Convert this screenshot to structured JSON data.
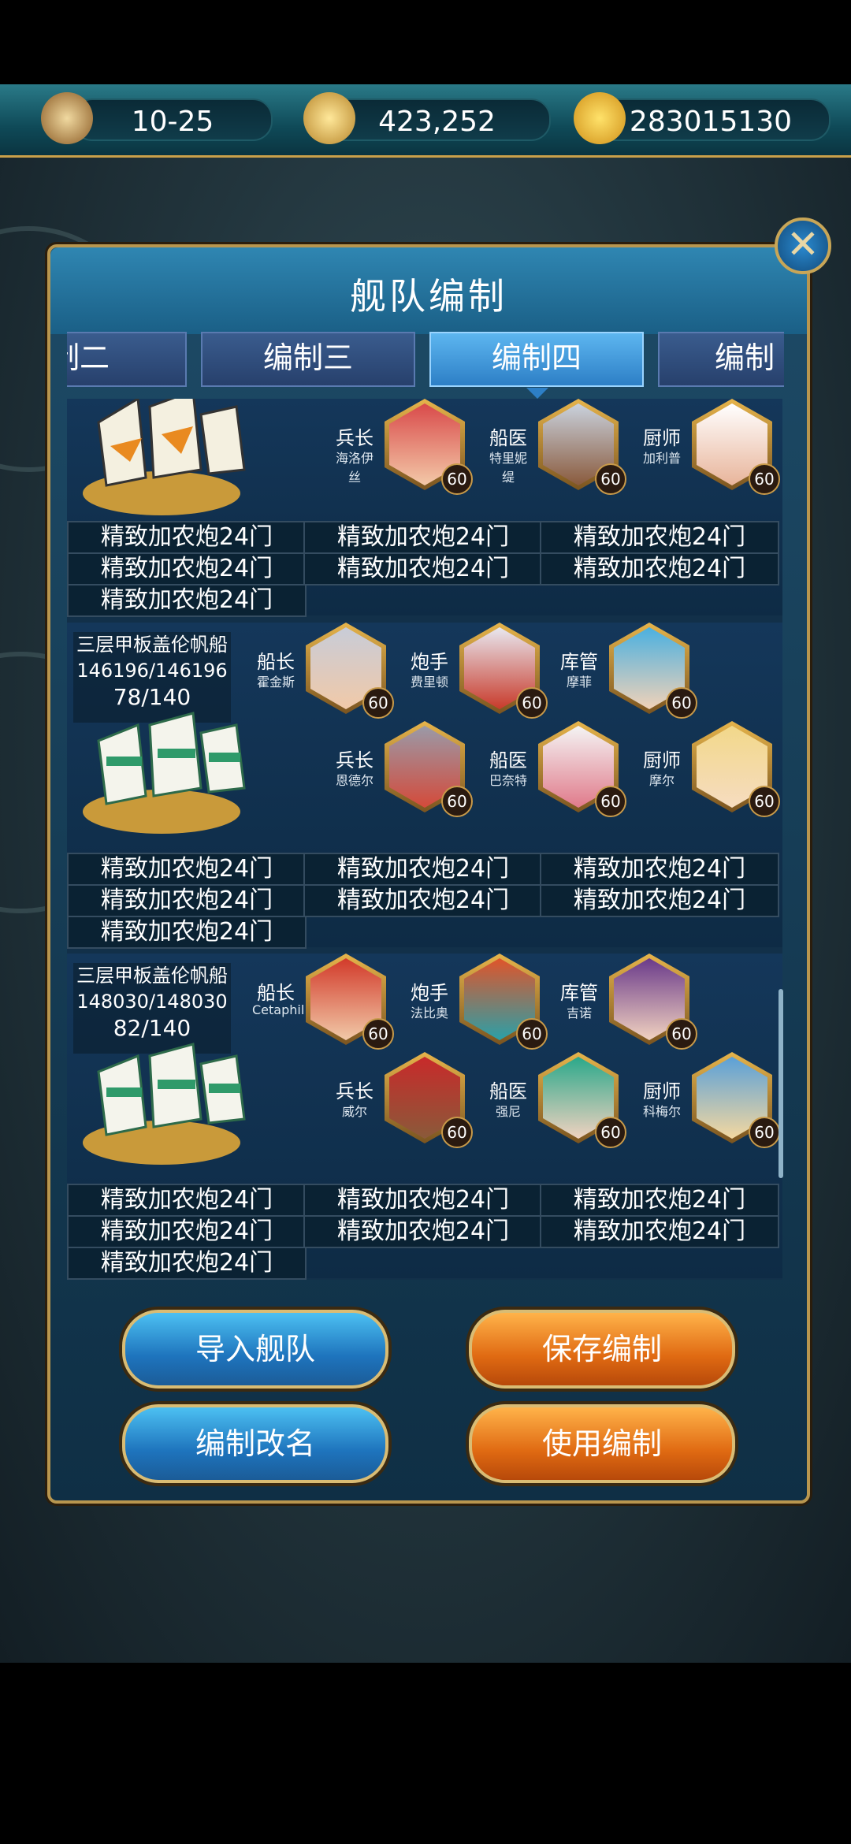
{
  "resources": [
    {
      "icon": "hourglass-icon",
      "value": "10-25"
    },
    {
      "icon": "compass-icon",
      "value": "423,252"
    },
    {
      "icon": "anchor-coin-icon",
      "value": "283015130"
    }
  ],
  "panel": {
    "title": "舰队编制",
    "close_icon": "close-icon"
  },
  "tabs": [
    {
      "label": "制二"
    },
    {
      "label": "编制三"
    },
    {
      "label": "编制四"
    },
    {
      "label": "编制"
    }
  ],
  "ships": [
    {
      "name": "",
      "hp": "",
      "capacity": "",
      "crew": [
        {
          "role": "兵长",
          "name": "海洛伊丝",
          "level": "60"
        },
        {
          "role": "船医",
          "name": "特里妮缇",
          "level": "60"
        },
        {
          "role": "厨师",
          "name": "加利普",
          "level": "60"
        }
      ],
      "equipment": [
        "精致加农炮24门",
        "精致加农炮24门",
        "精致加农炮24门",
        "精致加农炮24门",
        "精致加农炮24门",
        "精致加农炮24门",
        "精致加农炮24门"
      ]
    },
    {
      "name": "三层甲板盖伦帆船",
      "hp": "146196/146196",
      "capacity": "78/140",
      "crew": [
        {
          "role": "船长",
          "name": "霍金斯",
          "level": "60"
        },
        {
          "role": "炮手",
          "name": "费里顿",
          "level": "60"
        },
        {
          "role": "库管",
          "name": "摩菲",
          "level": "60"
        },
        {
          "role": "兵长",
          "name": "恩德尔",
          "level": "60"
        },
        {
          "role": "船医",
          "name": "巴奈特",
          "level": "60"
        },
        {
          "role": "厨师",
          "name": "摩尔",
          "level": "60"
        }
      ],
      "equipment": [
        "精致加农炮24门",
        "精致加农炮24门",
        "精致加农炮24门",
        "精致加农炮24门",
        "精致加农炮24门",
        "精致加农炮24门",
        "精致加农炮24门"
      ]
    },
    {
      "name": "三层甲板盖伦帆船",
      "hp": "148030/148030",
      "capacity": "82/140",
      "crew": [
        {
          "role": "船长",
          "name": "Cetaphil",
          "level": "60"
        },
        {
          "role": "炮手",
          "name": "法比奥",
          "level": "60"
        },
        {
          "role": "库管",
          "name": "吉诺",
          "level": "60"
        },
        {
          "role": "兵长",
          "name": "威尔",
          "level": "60"
        },
        {
          "role": "船医",
          "name": "强尼",
          "level": "60"
        },
        {
          "role": "厨师",
          "name": "科梅尔",
          "level": "60"
        }
      ],
      "equipment": [
        "精致加农炮24门",
        "精致加农炮24门",
        "精致加农炮24门",
        "精致加农炮24门",
        "精致加农炮24门",
        "精致加农炮24门",
        "精致加农炮24门"
      ]
    }
  ],
  "buttons": {
    "import": "导入舰队",
    "save": "保存编制",
    "rename": "编制改名",
    "use": "使用编制"
  },
  "colors": {
    "accent_gold": "#c9a04a",
    "blue_button": "#1e74bd",
    "orange_button": "#e06a12"
  }
}
